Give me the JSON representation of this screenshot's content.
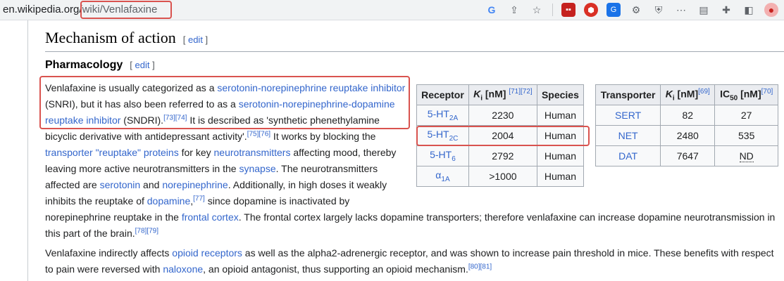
{
  "browser": {
    "url_host": "en.wikipedia.org/",
    "url_path": "wiki/Venlafaxine",
    "icons": [
      "google-icon",
      "share-icon",
      "star-icon",
      "extension-red-icon",
      "ublock-icon",
      "translate-icon",
      "gear-icon",
      "shield-icon",
      "dots-circle-icon",
      "reader-icon",
      "puzzle-icon",
      "sidebar-icon",
      "profile-avatar-icon"
    ]
  },
  "article": {
    "section_title": "Mechanism of action",
    "section_edit": "edit",
    "subsection_title": "Pharmacology",
    "subsection_edit": "edit",
    "para1": {
      "l1_a": "Venlafaxine is usually categorized as a ",
      "l1_link": "serotonin-norepinephrine reuptake inhibitor",
      "l2_a": "(SNRI), but it has also been referred to as a ",
      "l2_link": "serotonin-norepinephrine-dopamine",
      "l3_link": "reuptake inhibitor",
      "l3_b": " (SNDRI).",
      "l3_ref": "[73][74]",
      "l3_c": " It is described as 'synthetic phenethylamine",
      "l4_a": "bicyclic derivative with antidepressant activity'.",
      "l4_ref": "[75][76]",
      "l4_b": " It works by blocking the",
      "l5_link1": "transporter \"reuptake\" proteins",
      "l5_b": " for key ",
      "l5_link2": "neurotransmitters",
      "l5_c": " affecting mood, thereby",
      "l6_a": "leaving more active neurotransmitters in the ",
      "l6_link": "synapse",
      "l6_b": ". The neurotransmitters",
      "l7_a": "affected are ",
      "l7_link1": "serotonin",
      "l7_b": " and ",
      "l7_link2": "norepinephrine",
      "l7_c": ". Additionally, in high doses it weakly",
      "l8_a": "inhibits the reuptake of ",
      "l8_link": "dopamine",
      "l8_b": ",",
      "l8_ref": "[77]",
      "l8_c": " since dopamine is inactivated by",
      "l9_a": "norepinephrine reuptake in the ",
      "l9_link": "frontal cortex",
      "l9_b": ". The frontal cortex largely lacks dopamine transporters; therefore venlafaxine can increase dopamine neurotransmission in",
      "l10_a": "this part of the brain.",
      "l10_ref": "[78][79]"
    },
    "para2": {
      "l1_a": "Venlafaxine indirectly affects ",
      "l1_link": "opioid receptors",
      "l1_b": " as well as the alpha2-adrenergic receptor, and was shown to increase pain threshold in mice. These benefits with respect",
      "l2_a": "to pain were reversed with ",
      "l2_link": "naloxone",
      "l2_b": ", an opioid antagonist, thus supporting an opioid mechanism.",
      "l2_ref": "[80][81]"
    }
  },
  "receptor_table": {
    "headers": {
      "receptor": "Receptor",
      "ki_k": "K",
      "ki_i": "i",
      "ki_rest": " [nM] ",
      "ki_ref": "[71][72]",
      "species": "Species"
    },
    "rows": [
      {
        "r_base": "5-HT",
        "r_sub": "2A",
        "ki": "2230",
        "species": "Human"
      },
      {
        "r_base": "5-HT",
        "r_sub": "2C",
        "ki": "2004",
        "species": "Human"
      },
      {
        "r_base": "5-HT",
        "r_sub": "6",
        "ki": "2792",
        "species": "Human"
      },
      {
        "r_base": "α",
        "r_sub": "1A",
        "ki": ">1000",
        "species": "Human"
      }
    ]
  },
  "transporter_table": {
    "headers": {
      "transporter": "Transporter",
      "ki_k": "K",
      "ki_i": "i",
      "ki_rest": " [nM]",
      "ki_ref": "[69]",
      "ic_a": "IC",
      "ic_sub": "50",
      "ic_rest": " [nM]",
      "ic_ref": "[70]"
    },
    "rows": [
      {
        "name": "SERT",
        "ki": "82",
        "ic": "27"
      },
      {
        "name": "NET",
        "ki": "2480",
        "ic": "535"
      },
      {
        "name": "DAT",
        "ki": "7647",
        "ic": "ND"
      }
    ]
  }
}
